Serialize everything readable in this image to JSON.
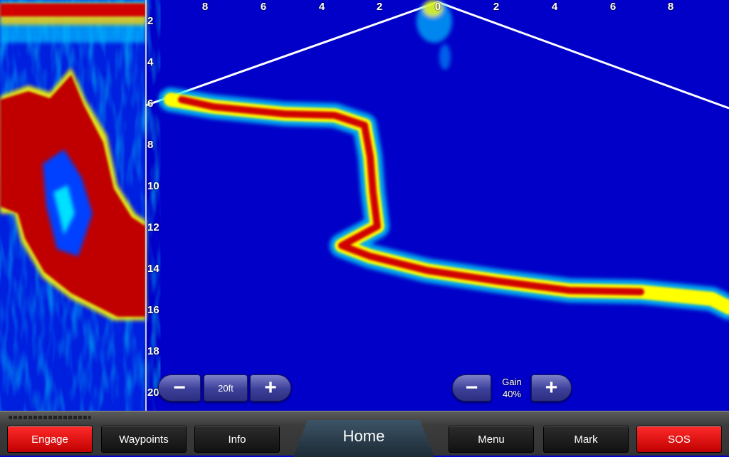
{
  "depth_scale": {
    "labels": [
      "2",
      "4",
      "6",
      "8",
      "10",
      "12",
      "14",
      "16",
      "18",
      "20"
    ]
  },
  "range_scale": {
    "labels": [
      "8",
      "6",
      "4",
      "2",
      "0",
      "2",
      "4",
      "6",
      "8"
    ]
  },
  "range_control": {
    "minus_icon": "minus-icon",
    "value": "20ft",
    "plus_icon": "plus-icon"
  },
  "gain_control": {
    "label": "Gain",
    "value": "40%",
    "minus_icon": "minus-icon",
    "plus_icon": "plus-icon"
  },
  "bottom_bar": {
    "engage": "Engage",
    "waypoints": "Waypoints",
    "info": "Info",
    "home": "Home",
    "menu": "Menu",
    "mark": "Mark",
    "sos": "SOS"
  },
  "colors": {
    "water": "#0000c8",
    "strong_return": "#c00000",
    "alarm_button": "#e00000"
  }
}
